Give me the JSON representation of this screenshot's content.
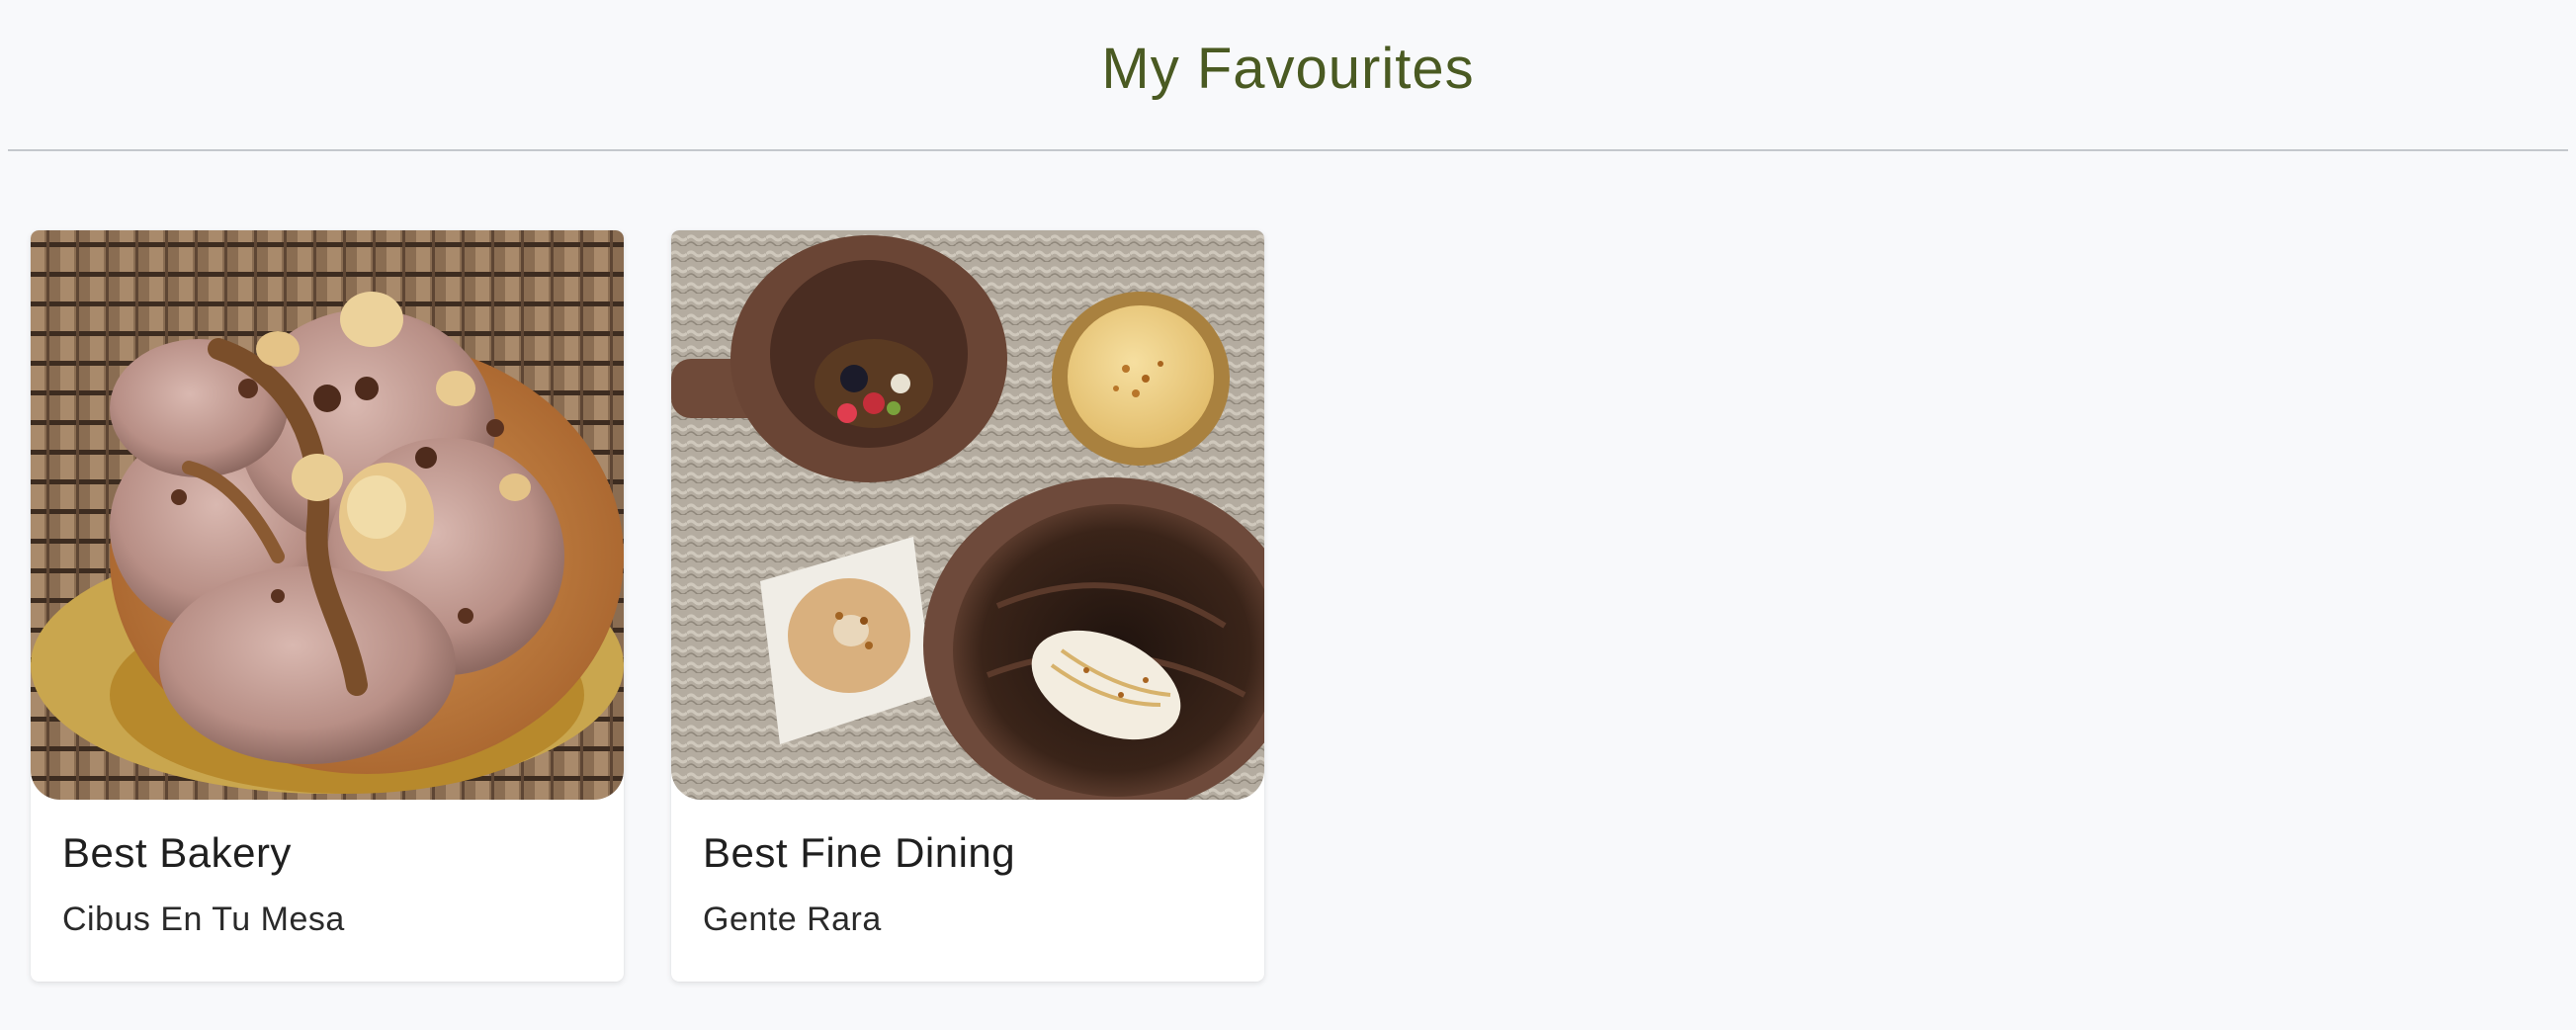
{
  "header": {
    "title": "My Favourites"
  },
  "favourites": [
    {
      "category": "Best Bakery",
      "name": "Cibus En Tu Mesa",
      "image": "chocolate-hazelnut-tart-photo"
    },
    {
      "category": "Best Fine Dining",
      "name": "Gente Rara",
      "image": "tasting-menu-desserts-photo"
    }
  ],
  "colors": {
    "title": "#4a5a22",
    "background": "#f8f9fb",
    "card": "#ffffff",
    "divider": "#c4c8cc"
  }
}
